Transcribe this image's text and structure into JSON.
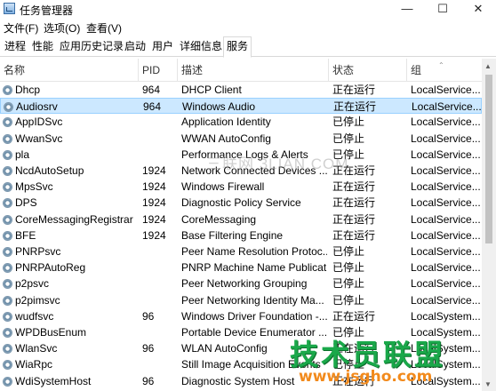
{
  "window": {
    "title": "任务管理器"
  },
  "window_controls": {
    "minimize": "—",
    "maximize": "☐",
    "close": "✕"
  },
  "menu": [
    "文件(F)",
    "选项(O)",
    "查看(V)"
  ],
  "tabs": [
    "进程",
    "性能",
    "应用历史记录",
    "启动",
    "用户",
    "详细信息",
    "服务"
  ],
  "active_tab": "服务",
  "columns": [
    "名称",
    "PID",
    "描述",
    "状态",
    "组"
  ],
  "rows": [
    {
      "name": "Dhcp",
      "pid": "964",
      "desc": "DHCP Client",
      "status": "正在运行",
      "group": "LocalService..."
    },
    {
      "name": "Audiosrv",
      "pid": "964",
      "desc": "Windows Audio",
      "status": "正在运行",
      "group": "LocalService..."
    },
    {
      "name": "AppIDSvc",
      "pid": "",
      "desc": "Application Identity",
      "status": "已停止",
      "group": "LocalService..."
    },
    {
      "name": "WwanSvc",
      "pid": "",
      "desc": "WWAN AutoConfig",
      "status": "已停止",
      "group": "LocalService..."
    },
    {
      "name": "pla",
      "pid": "",
      "desc": "Performance Logs & Alerts",
      "status": "已停止",
      "group": "LocalService..."
    },
    {
      "name": "NcdAutoSetup",
      "pid": "1924",
      "desc": "Network Connected Devices ...",
      "status": "正在运行",
      "group": "LocalService..."
    },
    {
      "name": "MpsSvc",
      "pid": "1924",
      "desc": "Windows Firewall",
      "status": "正在运行",
      "group": "LocalService..."
    },
    {
      "name": "DPS",
      "pid": "1924",
      "desc": "Diagnostic Policy Service",
      "status": "正在运行",
      "group": "LocalService..."
    },
    {
      "name": "CoreMessagingRegistrar",
      "pid": "1924",
      "desc": "CoreMessaging",
      "status": "正在运行",
      "group": "LocalService..."
    },
    {
      "name": "BFE",
      "pid": "1924",
      "desc": "Base Filtering Engine",
      "status": "正在运行",
      "group": "LocalService..."
    },
    {
      "name": "PNRPsvc",
      "pid": "",
      "desc": "Peer Name Resolution Protoc...",
      "status": "已停止",
      "group": "LocalService..."
    },
    {
      "name": "PNRPAutoReg",
      "pid": "",
      "desc": "PNRP Machine Name Publicat...",
      "status": "已停止",
      "group": "LocalService..."
    },
    {
      "name": "p2psvc",
      "pid": "",
      "desc": "Peer Networking Grouping",
      "status": "已停止",
      "group": "LocalService..."
    },
    {
      "name": "p2pimsvc",
      "pid": "",
      "desc": "Peer Networking Identity Ma...",
      "status": "已停止",
      "group": "LocalService..."
    },
    {
      "name": "wudfsvc",
      "pid": "96",
      "desc": "Windows Driver Foundation -...",
      "status": "正在运行",
      "group": "LocalSystem..."
    },
    {
      "name": "WPDBusEnum",
      "pid": "",
      "desc": "Portable Device Enumerator ...",
      "status": "已停止",
      "group": "LocalSystem..."
    },
    {
      "name": "WlanSvc",
      "pid": "96",
      "desc": "WLAN AutoConfig",
      "status": "正在运行",
      "group": "LocalSystem..."
    },
    {
      "name": "WiaRpc",
      "pid": "",
      "desc": "Still Image Acquisition Events",
      "status": "已停止",
      "group": "LocalSystem..."
    },
    {
      "name": "WdiSystemHost",
      "pid": "96",
      "desc": "Diagnostic System Host",
      "status": "正在运行",
      "group": "LocalSystem..."
    }
  ],
  "selected_row": "Audiosrv",
  "sort_indicator": "⌃",
  "watermark": "三联网 3LIAN.COM",
  "logo": {
    "title": "技术员联盟",
    "url": "www.jsgho.com"
  },
  "colors": {
    "selection_bg": "#cce8ff",
    "selection_border": "#99d1ff",
    "logo_green": "#1aa84a",
    "logo_orange": "#f28a1c"
  }
}
